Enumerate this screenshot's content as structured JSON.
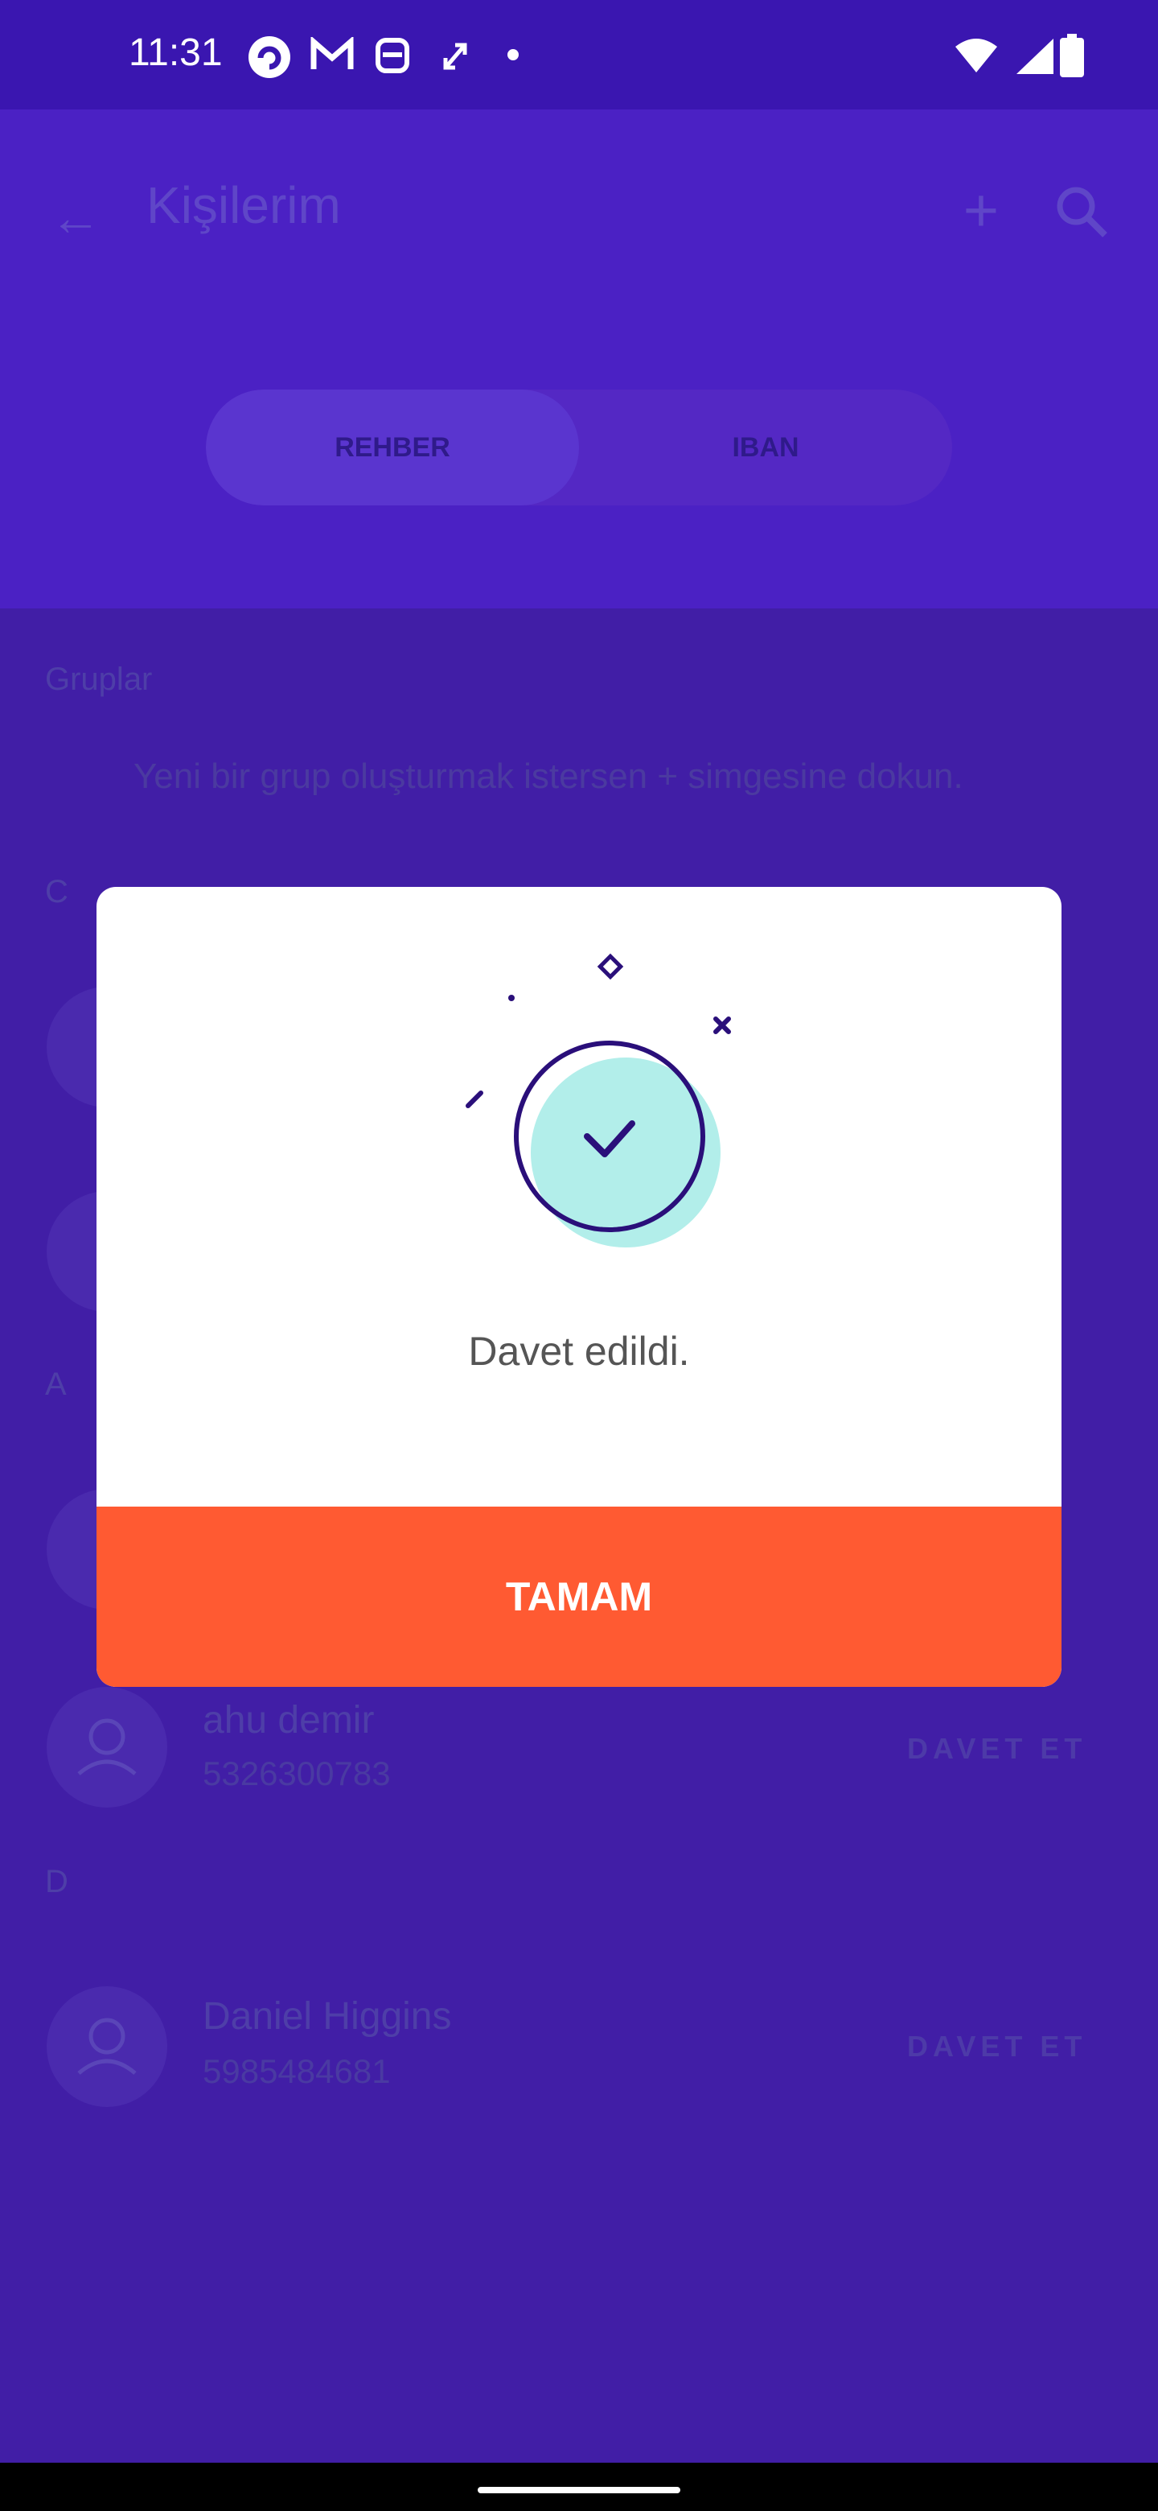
{
  "status_bar": {
    "time": "11:31",
    "icons": [
      "app-icon",
      "gmail-icon",
      "security-icon",
      "transfer-icon",
      "dot-icon",
      "wifi-icon",
      "signal-icon",
      "battery-icon"
    ]
  },
  "header": {
    "title": "Kişilerim",
    "tabs": [
      {
        "label": "REHBER",
        "selected": true
      },
      {
        "label": "IBAN",
        "selected": false
      }
    ]
  },
  "groups": {
    "section_label": "Gruplar",
    "empty_text": "Yeni bir grup oluşturmak istersen + simgesine dokun."
  },
  "contacts": {
    "section_c": "C",
    "section_a": "A",
    "section_d": "D",
    "invite_label": "DAVET ET",
    "rows": [
      {
        "name": "ahu demir",
        "phone": "5326300783"
      },
      {
        "name": "Daniel Higgins",
        "phone": "5985484681"
      }
    ]
  },
  "dialog": {
    "message": "Davet edildi.",
    "button_label": "TAMAM"
  },
  "colors": {
    "background": "#411ea6",
    "status_bar": "#3a16b0",
    "accent": "#ff5a32",
    "success_circle": "#b2eeea",
    "outline": "#2a0f7a"
  }
}
